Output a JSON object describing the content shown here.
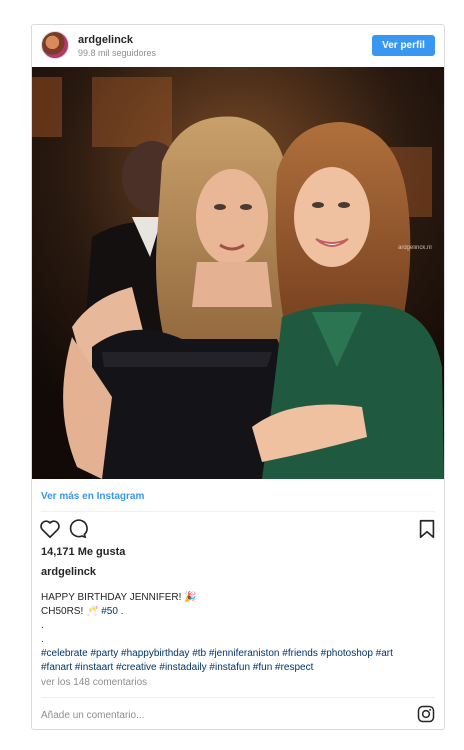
{
  "header": {
    "username": "ardgelinck",
    "followers": "99.8 mil seguidores",
    "profile_button": "Ver perfil"
  },
  "photo": {
    "watermark": "ardgelinck.nl"
  },
  "link": {
    "more_on_instagram": "Ver más en Instagram"
  },
  "actions": {
    "like_icon": "heart-icon",
    "comment_icon": "comment-icon",
    "save_icon": "bookmark-icon"
  },
  "likes": "14,171 Me gusta",
  "caption": {
    "username": "ardgelinck",
    "line1": "HAPPY BIRTHDAY JENNIFER! 🎉",
    "line2_text": "CH50RS! 🥂 ",
    "line2_tag": "#50",
    "line2_end": " .",
    "dot1": ".",
    "dot2": ".",
    "hashtags_line1": "#celebrate #party #happybirthday #tb #jenniferaniston #friends #photoshop #art",
    "hashtags_line2": "#fanart #instaart #creative #instadaily #instafun #fun #respect"
  },
  "comments_link": "ver los 148 comentarios",
  "comment_box": {
    "placeholder": "Añade un comentario..."
  },
  "colors": {
    "accent": "#3897f0",
    "hashtag": "#003569",
    "muted": "#8e8e8e"
  }
}
